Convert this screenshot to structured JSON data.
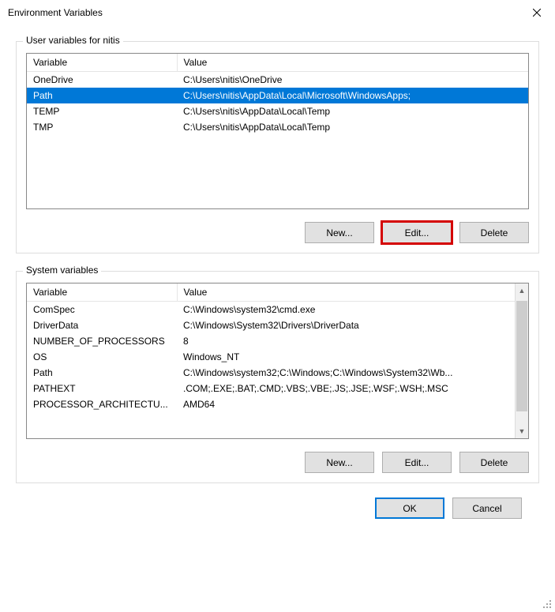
{
  "window": {
    "title": "Environment Variables"
  },
  "userVars": {
    "groupLabel": "User variables for nitis",
    "columns": {
      "var": "Variable",
      "val": "Value"
    },
    "rows": [
      {
        "var": "OneDrive",
        "val": "C:\\Users\\nitis\\OneDrive",
        "selected": false
      },
      {
        "var": "Path",
        "val": "C:\\Users\\nitis\\AppData\\Local\\Microsoft\\WindowsApps;",
        "selected": true
      },
      {
        "var": "TEMP",
        "val": "C:\\Users\\nitis\\AppData\\Local\\Temp",
        "selected": false
      },
      {
        "var": "TMP",
        "val": "C:\\Users\\nitis\\AppData\\Local\\Temp",
        "selected": false
      }
    ],
    "buttons": {
      "new": "New...",
      "edit": "Edit...",
      "delete": "Delete"
    }
  },
  "sysVars": {
    "groupLabel": "System variables",
    "columns": {
      "var": "Variable",
      "val": "Value"
    },
    "rows": [
      {
        "var": "ComSpec",
        "val": "C:\\Windows\\system32\\cmd.exe"
      },
      {
        "var": "DriverData",
        "val": "C:\\Windows\\System32\\Drivers\\DriverData"
      },
      {
        "var": "NUMBER_OF_PROCESSORS",
        "val": "8"
      },
      {
        "var": "OS",
        "val": "Windows_NT"
      },
      {
        "var": "Path",
        "val": "C:\\Windows\\system32;C:\\Windows;C:\\Windows\\System32\\Wb..."
      },
      {
        "var": "PATHEXT",
        "val": ".COM;.EXE;.BAT;.CMD;.VBS;.VBE;.JS;.JSE;.WSF;.WSH;.MSC"
      },
      {
        "var": "PROCESSOR_ARCHITECTU...",
        "val": "AMD64"
      }
    ],
    "buttons": {
      "new": "New...",
      "edit": "Edit...",
      "delete": "Delete"
    }
  },
  "dialogButtons": {
    "ok": "OK",
    "cancel": "Cancel"
  }
}
